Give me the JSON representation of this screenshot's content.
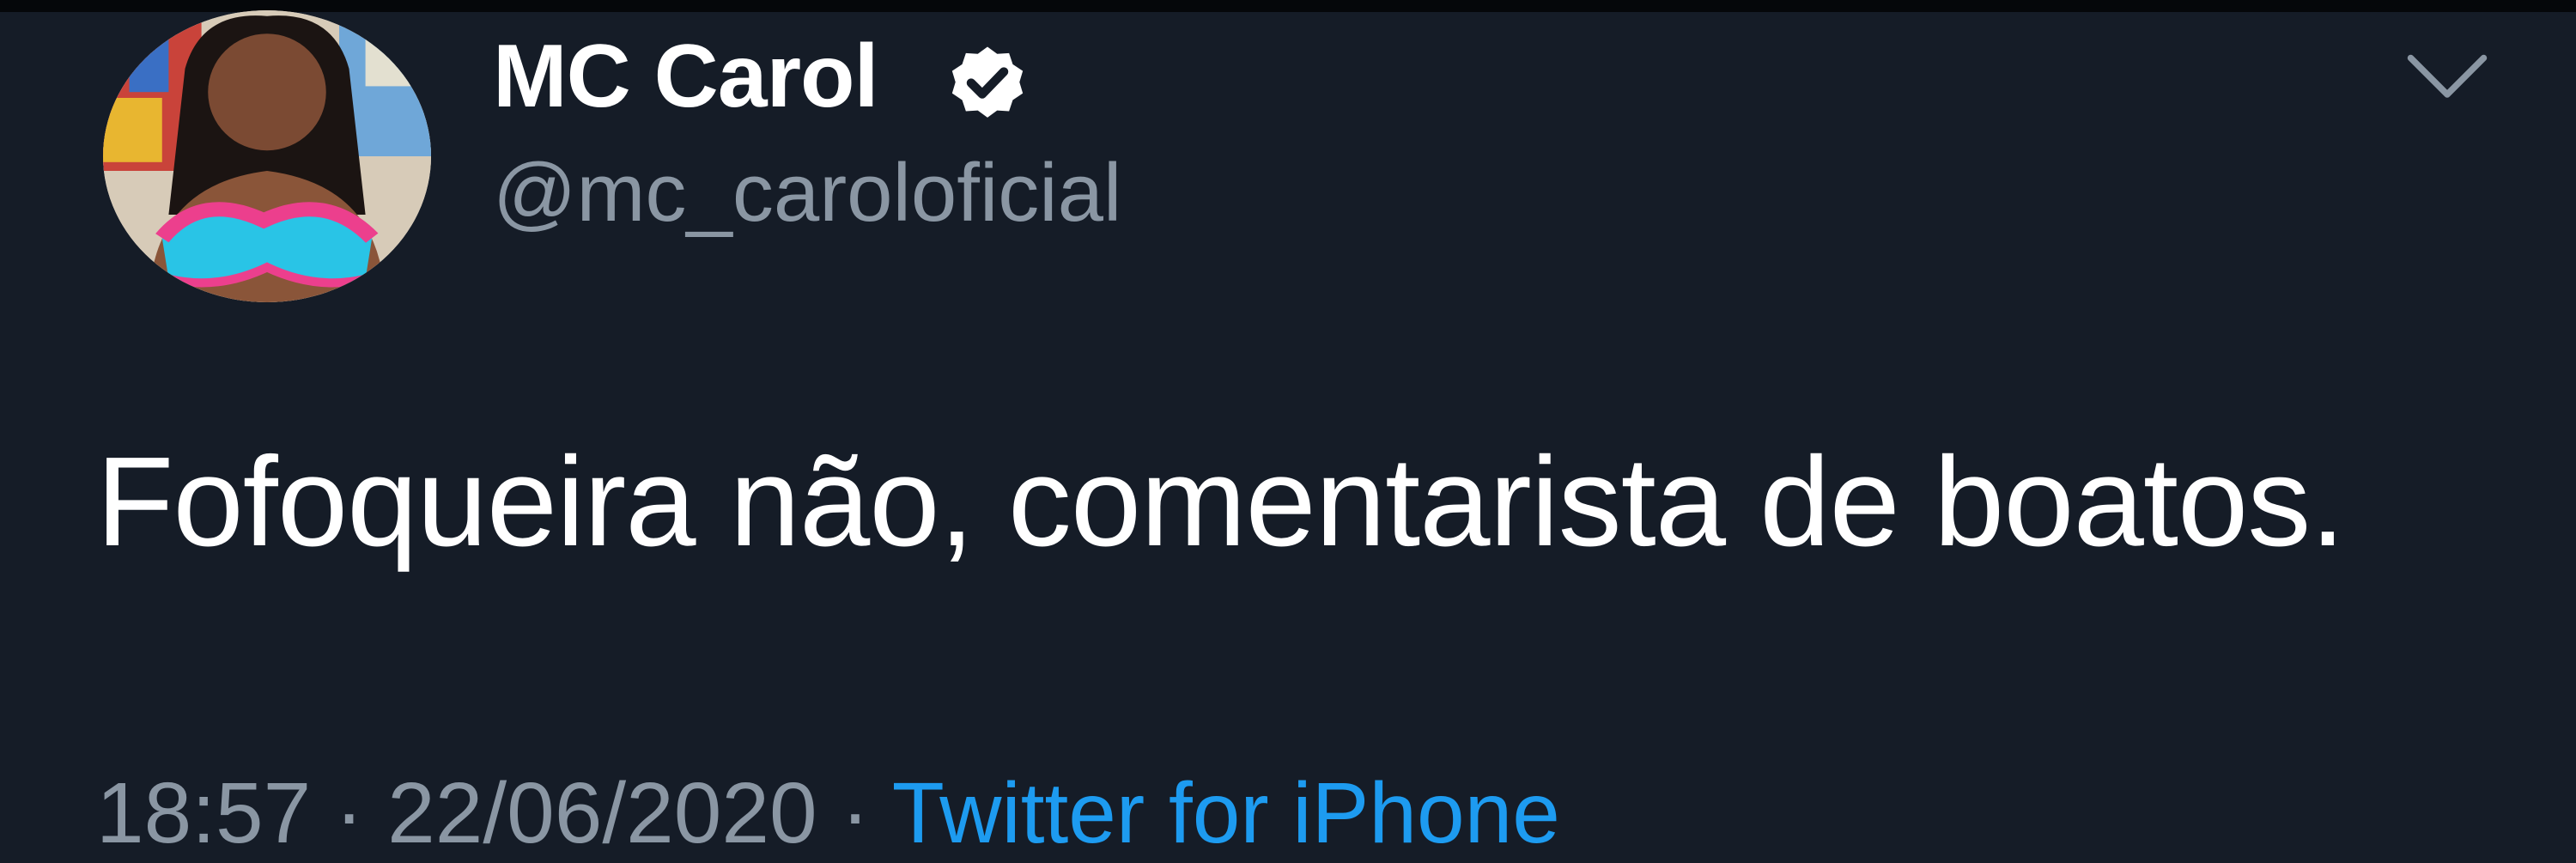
{
  "tweet": {
    "author": {
      "display_name": "MC Carol",
      "handle": "@mc_caroloficial",
      "verified": true
    },
    "text": "Fofoqueira não, comentarista de boatos.",
    "time": "18:57",
    "date": "22/06/2020",
    "separator": " · ",
    "source": "Twitter for iPhone",
    "icons": {
      "verified": "verified-badge-icon",
      "menu": "chevron-down-icon"
    },
    "colors": {
      "background": "#151c27",
      "primary_text": "#ffffff",
      "secondary_text": "#8a96a3",
      "link": "#1d9bf0"
    }
  }
}
